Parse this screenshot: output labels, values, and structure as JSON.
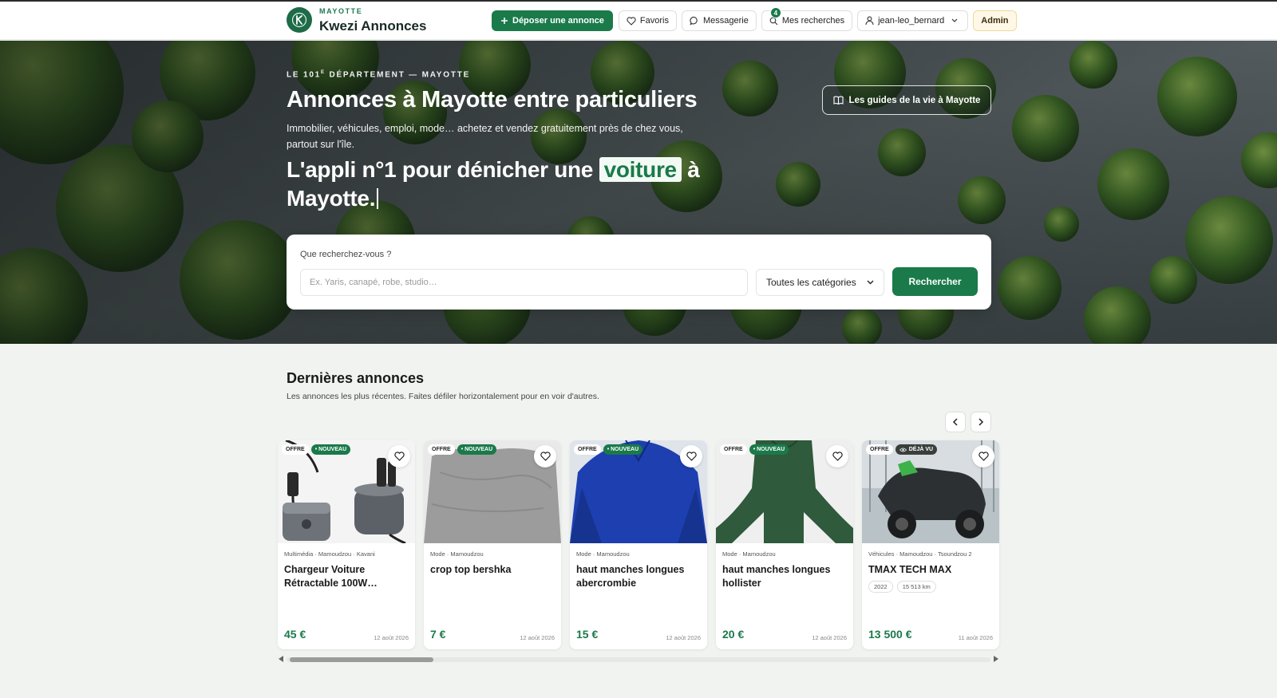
{
  "header": {
    "brand_sub": "MAYOTTE",
    "brand_name": "Kwezi Annonces",
    "deposit_label": "Déposer une annonce",
    "favoris_label": "Favoris",
    "messagerie_label": "Messagerie",
    "recherches_label": "Mes recherches",
    "recherches_badge": "4",
    "user_label": "jean-leo_bernard",
    "admin_label": "Admin"
  },
  "hero": {
    "eyebrow_pre": "LE 101",
    "eyebrow_sup": "E",
    "eyebrow_post": " DÉPARTEMENT — MAYOTTE",
    "title": "Annonces à Mayotte entre particuliers",
    "description": "Immobilier, véhicules, emploi, mode… achetez et vendez gratuitement près de chez vous, partout sur l'île.",
    "slogan_before": "L'appli n°1 pour dénicher une ",
    "slogan_highlight": "voiture",
    "slogan_after": " à Mayotte.",
    "guide_button": "Les guides de la vie à Mayotte"
  },
  "search": {
    "label": "Que recherchez-vous ?",
    "placeholder": "Ex. Yaris, canapé, robe, studio…",
    "category": "Toutes les catégories",
    "button": "Rechercher"
  },
  "listings": {
    "title": "Dernières annonces",
    "subtitle": "Les annonces les plus récentes. Faites défiler horizontalement pour en voir d'autres.",
    "cards": [
      {
        "tag1": "OFFRE",
        "tag2": "• NOUVEAU",
        "meta": "Multimédia · Mamoudzou · Kavani",
        "title": "Chargeur Voiture Rétractable 100W…",
        "price": "45 €",
        "date": "12 août 2026"
      },
      {
        "tag1": "OFFRE",
        "tag2": "• NOUVEAU",
        "meta": "Mode · Mamoudzou",
        "title": "crop top bershka",
        "price": "7 €",
        "date": "12 août 2026"
      },
      {
        "tag1": "OFFRE",
        "tag2": "• NOUVEAU",
        "meta": "Mode · Mamoudzou",
        "title": "haut manches longues abercrombie",
        "price": "15 €",
        "date": "12 août 2026"
      },
      {
        "tag1": "OFFRE",
        "tag2": "• NOUVEAU",
        "meta": "Mode · Mamoudzou",
        "title": "haut manches longues hollister",
        "price": "20 €",
        "date": "12 août 2026"
      },
      {
        "tag1": "OFFRE",
        "tag2": "DÉJÀ VU",
        "meta": "Véhicules · Mamoudzou · Tsoundzou 2",
        "title": "TMAX TECH MAX",
        "chip1": "2022",
        "chip2": "15 513 km",
        "price": "13 500 €",
        "date": "11 août 2026"
      }
    ]
  },
  "colors": {
    "accent": "#1a7a4a",
    "brand_logo": "#1d6b47",
    "page_bg": "#f1f3f1"
  }
}
